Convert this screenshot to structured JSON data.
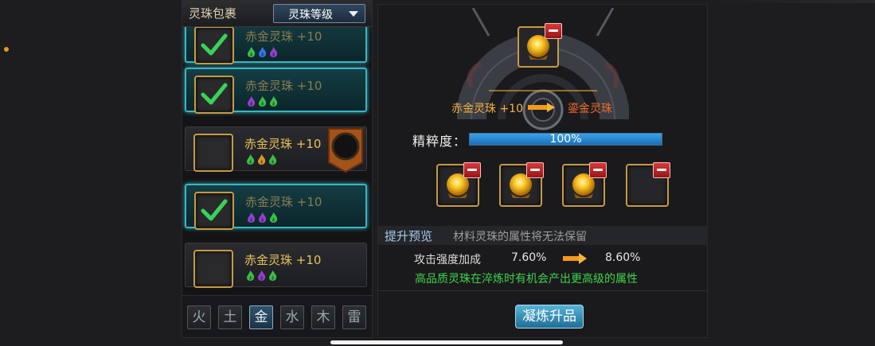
{
  "bag": {
    "title": "灵珠包裹",
    "sort_label": "灵珠等级",
    "items": [
      {
        "name": "赤金灵珠 +10",
        "selected": true,
        "elements": [
          "green",
          "blue",
          "purple"
        ]
      },
      {
        "name": "赤金灵珠 +10",
        "selected": true,
        "elements": [
          "purple",
          "green",
          "green"
        ]
      },
      {
        "name": "赤金灵珠 +10",
        "selected": false,
        "elements": [
          "green",
          "orange",
          "green"
        ]
      },
      {
        "name": "赤金灵珠 +10",
        "selected": true,
        "elements": [
          "purple",
          "purple",
          "green"
        ]
      },
      {
        "name": "赤金灵珠 +10",
        "selected": false,
        "elements": [
          "green",
          "purple",
          "green"
        ]
      }
    ],
    "element_tabs": [
      "火",
      "土",
      "金",
      "水",
      "木",
      "雷"
    ],
    "active_tab": "金"
  },
  "refine": {
    "from_name": "赤金灵珠 +10",
    "to_name": "鎏金灵珠",
    "purity_label": "精粹度：",
    "purity_value": "100%",
    "purity_fraction": 1.0
  },
  "preview": {
    "title": "提升预览",
    "note": "材料灵珠的属性将无法保留",
    "stat_label": "攻击强度加成",
    "stat_old": "7.60%",
    "stat_new": "8.60%",
    "hint": "高品质灵珠在淬炼时有机会产出更高级的属性"
  },
  "refine_button": "凝炼升品",
  "colors": {
    "selected_border": "#39b6c2",
    "gold_frame": "#c79a43",
    "hint_green": "#3fd44b",
    "target_orange": "#ef6a2a"
  }
}
